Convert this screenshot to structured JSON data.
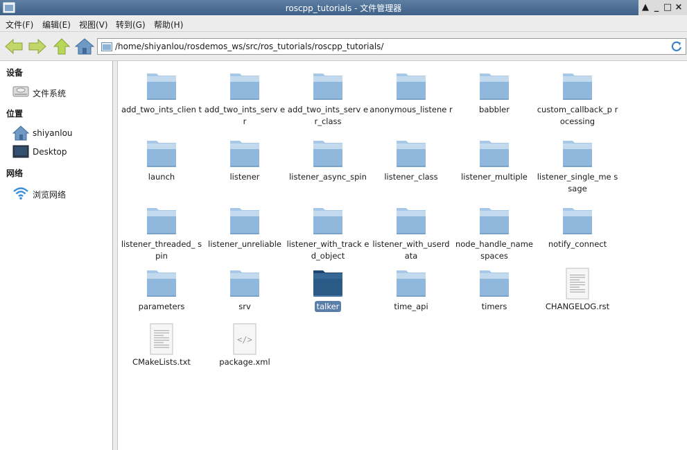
{
  "window": {
    "title": "roscpp_tutorials - 文件管理器",
    "controls": [
      "▲",
      "_",
      "□",
      "×"
    ]
  },
  "menu": {
    "items": [
      "文件(F)",
      "编辑(E)",
      "视图(V)",
      "转到(G)",
      "帮助(H)"
    ]
  },
  "toolbar": {
    "path": "/home/shiyanlou/rosdemos_ws/src/ros_tutorials/roscpp_tutorials/"
  },
  "sidebar": {
    "sections": [
      {
        "heading": "设备",
        "items": [
          {
            "label": "文件系统",
            "icon": "drive-icon"
          }
        ]
      },
      {
        "heading": "位置",
        "items": [
          {
            "label": "shiyanlou",
            "icon": "home-icon"
          },
          {
            "label": "Desktop",
            "icon": "desktop-icon"
          }
        ]
      },
      {
        "heading": "网络",
        "items": [
          {
            "label": "浏览网络",
            "icon": "network-icon"
          }
        ]
      }
    ]
  },
  "files": [
    {
      "name": "add_two_ints_clien t",
      "type": "folder"
    },
    {
      "name": "add_two_ints_serv er",
      "type": "folder"
    },
    {
      "name": "add_two_ints_serv er_class",
      "type": "folder"
    },
    {
      "name": "anonymous_listene r",
      "type": "folder"
    },
    {
      "name": "babbler",
      "type": "folder"
    },
    {
      "name": "custom_callback_p rocessing",
      "type": "folder"
    },
    {
      "name": "launch",
      "type": "folder"
    },
    {
      "name": "listener",
      "type": "folder"
    },
    {
      "name": "listener_async_spin",
      "type": "folder"
    },
    {
      "name": "listener_class",
      "type": "folder"
    },
    {
      "name": "listener_multiple",
      "type": "folder"
    },
    {
      "name": "listener_single_me ssage",
      "type": "folder"
    },
    {
      "name": "listener_threaded_ spin",
      "type": "folder"
    },
    {
      "name": "listener_unreliable",
      "type": "folder"
    },
    {
      "name": "listener_with_track ed_object",
      "type": "folder"
    },
    {
      "name": "listener_with_userd ata",
      "type": "folder"
    },
    {
      "name": "node_handle_name spaces",
      "type": "folder"
    },
    {
      "name": "notify_connect",
      "type": "folder"
    },
    {
      "name": "parameters",
      "type": "folder"
    },
    {
      "name": "srv",
      "type": "folder"
    },
    {
      "name": "talker",
      "type": "folder-selected"
    },
    {
      "name": "time_api",
      "type": "folder"
    },
    {
      "name": "timers",
      "type": "folder"
    },
    {
      "name": "CHANGELOG.rst",
      "type": "text"
    },
    {
      "name": "CMakeLists.txt",
      "type": "text"
    },
    {
      "name": "package.xml",
      "type": "xml"
    }
  ],
  "colors": {
    "accent": "#5a7ea8",
    "folder": "#8fb8dc",
    "folder_selected": "#2c5a86"
  }
}
